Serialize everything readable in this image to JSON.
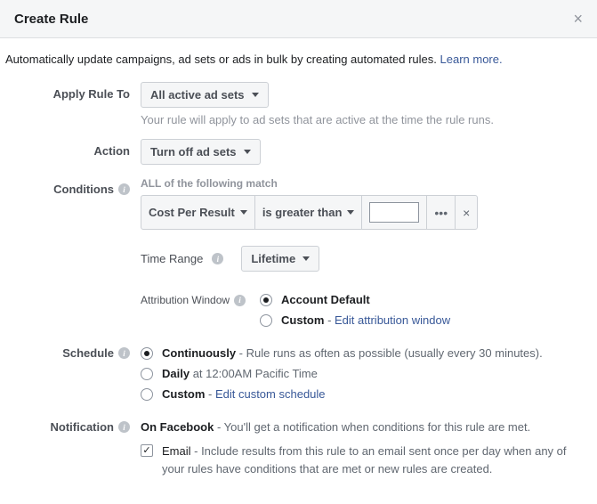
{
  "header": {
    "title": "Create Rule"
  },
  "intro": {
    "text": "Automatically update campaigns, ad sets or ads in bulk by creating automated rules. ",
    "learn_more": "Learn more."
  },
  "apply_rule": {
    "label": "Apply Rule To",
    "value": "All active ad sets",
    "hint": "Your rule will apply to ad sets that are active at the time the rule runs."
  },
  "action": {
    "label": "Action",
    "value": "Turn off ad sets"
  },
  "conditions": {
    "label": "Conditions",
    "header": "ALL of the following match",
    "metric": "Cost Per Result",
    "operator": "is greater than",
    "value": "",
    "time_range_label": "Time Range",
    "time_range_value": "Lifetime",
    "attribution_label": "Attribution Window",
    "attribution_default": "Account Default",
    "attribution_custom": "Custom",
    "attribution_edit": "Edit attribution window"
  },
  "schedule": {
    "label": "Schedule",
    "continuously": "Continuously",
    "continuously_desc": " - Rule runs as often as possible (usually every 30 minutes).",
    "daily": "Daily",
    "daily_desc": " at 12:00AM Pacific Time",
    "custom": "Custom",
    "custom_sep": " - ",
    "custom_edit": "Edit custom schedule"
  },
  "notification": {
    "label": "Notification",
    "on_fb": "On Facebook",
    "on_fb_desc": " - You'll get a notification when conditions for this rule are met.",
    "email_label": "Email",
    "email_desc": " - Include results from this rule to an email sent once per day when any of your rules have conditions that are met or new rules are created."
  }
}
